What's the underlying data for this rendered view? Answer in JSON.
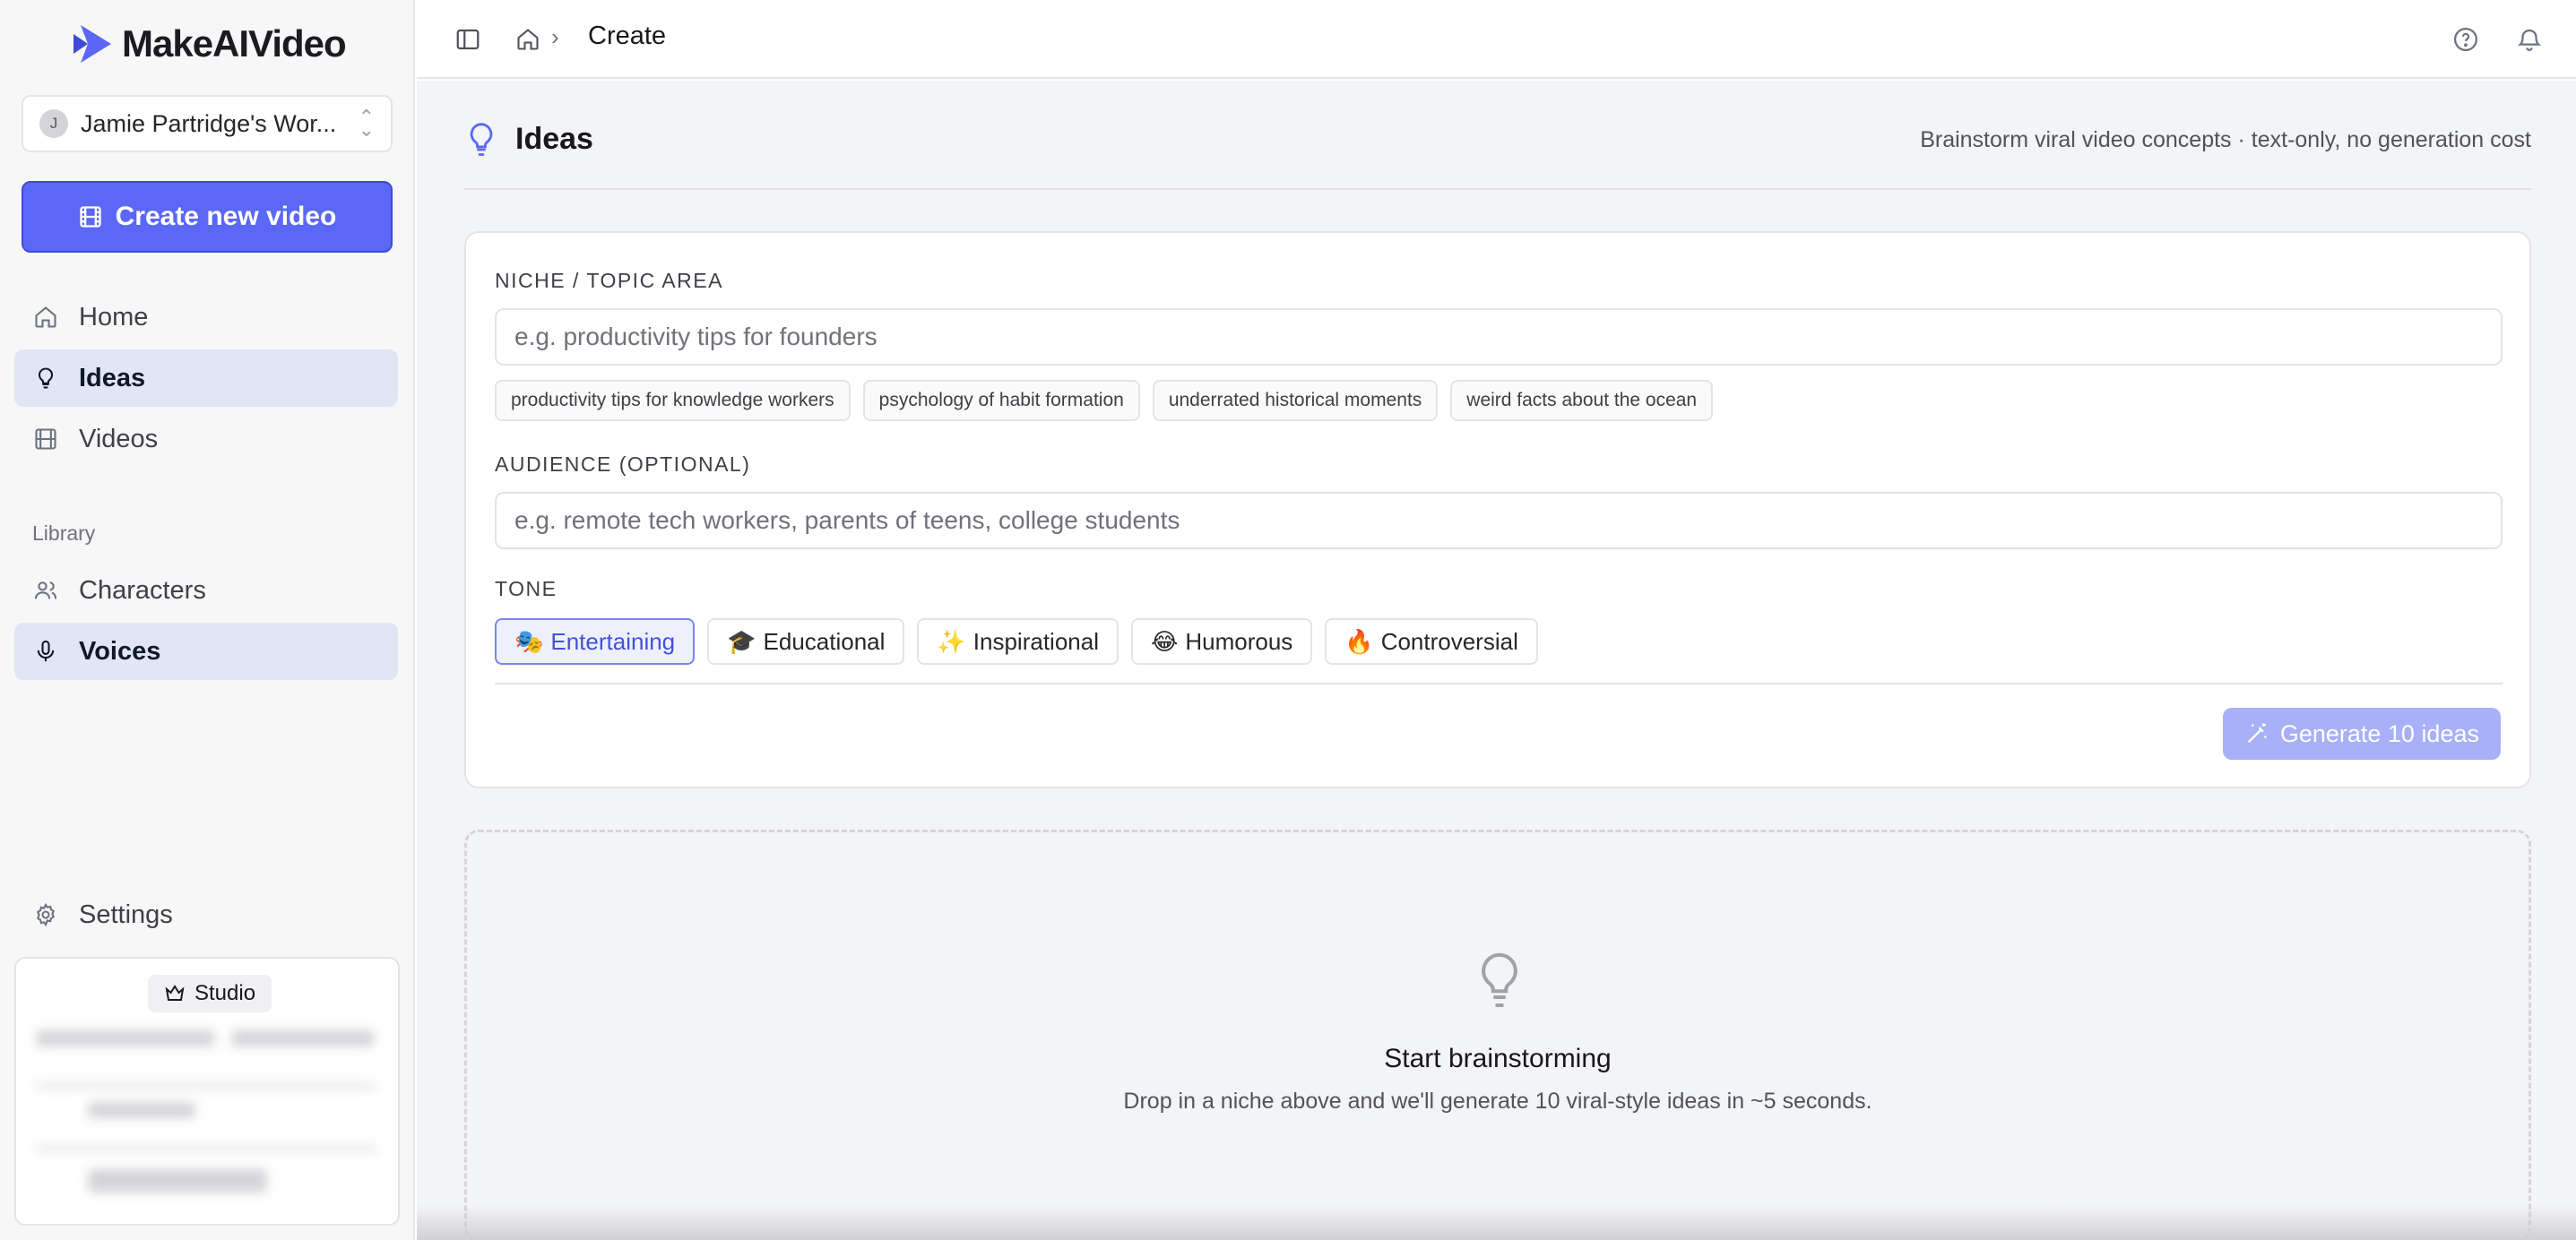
{
  "app": {
    "name": "MakeAIVideo"
  },
  "workspace": {
    "name": "Jamie Partridge's Wor...",
    "initial": "J"
  },
  "sidebar": {
    "create_button": "Create new video",
    "nav": [
      {
        "label": "Home",
        "icon": "home-icon"
      },
      {
        "label": "Ideas",
        "icon": "lightbulb-icon"
      },
      {
        "label": "Videos",
        "icon": "film-icon"
      }
    ],
    "library_label": "Library",
    "library": [
      {
        "label": "Characters",
        "icon": "users-icon"
      },
      {
        "label": "Voices",
        "icon": "microphone-icon"
      }
    ],
    "settings_label": "Settings",
    "plan": {
      "badge": "Studio"
    }
  },
  "header": {
    "breadcrumb_current": "Create"
  },
  "page": {
    "title": "Ideas",
    "subtitle": "Brainstorm viral video concepts · text-only, no generation cost"
  },
  "form": {
    "niche_label": "NICHE / TOPIC AREA",
    "niche_placeholder": "e.g. productivity tips for founders",
    "suggestions": [
      "productivity tips for knowledge workers",
      "psychology of habit formation",
      "underrated historical moments",
      "weird facts about the ocean"
    ],
    "audience_label": "AUDIENCE (OPTIONAL)",
    "audience_placeholder": "e.g. remote tech workers, parents of teens, college students",
    "tone_label": "TONE",
    "tones": [
      {
        "emoji": "🎭",
        "label": "Entertaining"
      },
      {
        "emoji": "🎓",
        "label": "Educational"
      },
      {
        "emoji": "✨",
        "label": "Inspirational"
      },
      {
        "emoji": "😂",
        "label": "Humorous"
      },
      {
        "emoji": "🔥",
        "label": "Controversial"
      }
    ],
    "selected_tone": "Entertaining",
    "generate_label": "Generate 10 ideas"
  },
  "empty_state": {
    "title": "Start brainstorming",
    "description": "Drop in a niche above and we'll generate 10 viral-style ideas in ~5 seconds."
  },
  "colors": {
    "accent": "#5b67f5",
    "accent_disabled": "#a8b0f7",
    "active_nav": "#e1e6f5"
  }
}
